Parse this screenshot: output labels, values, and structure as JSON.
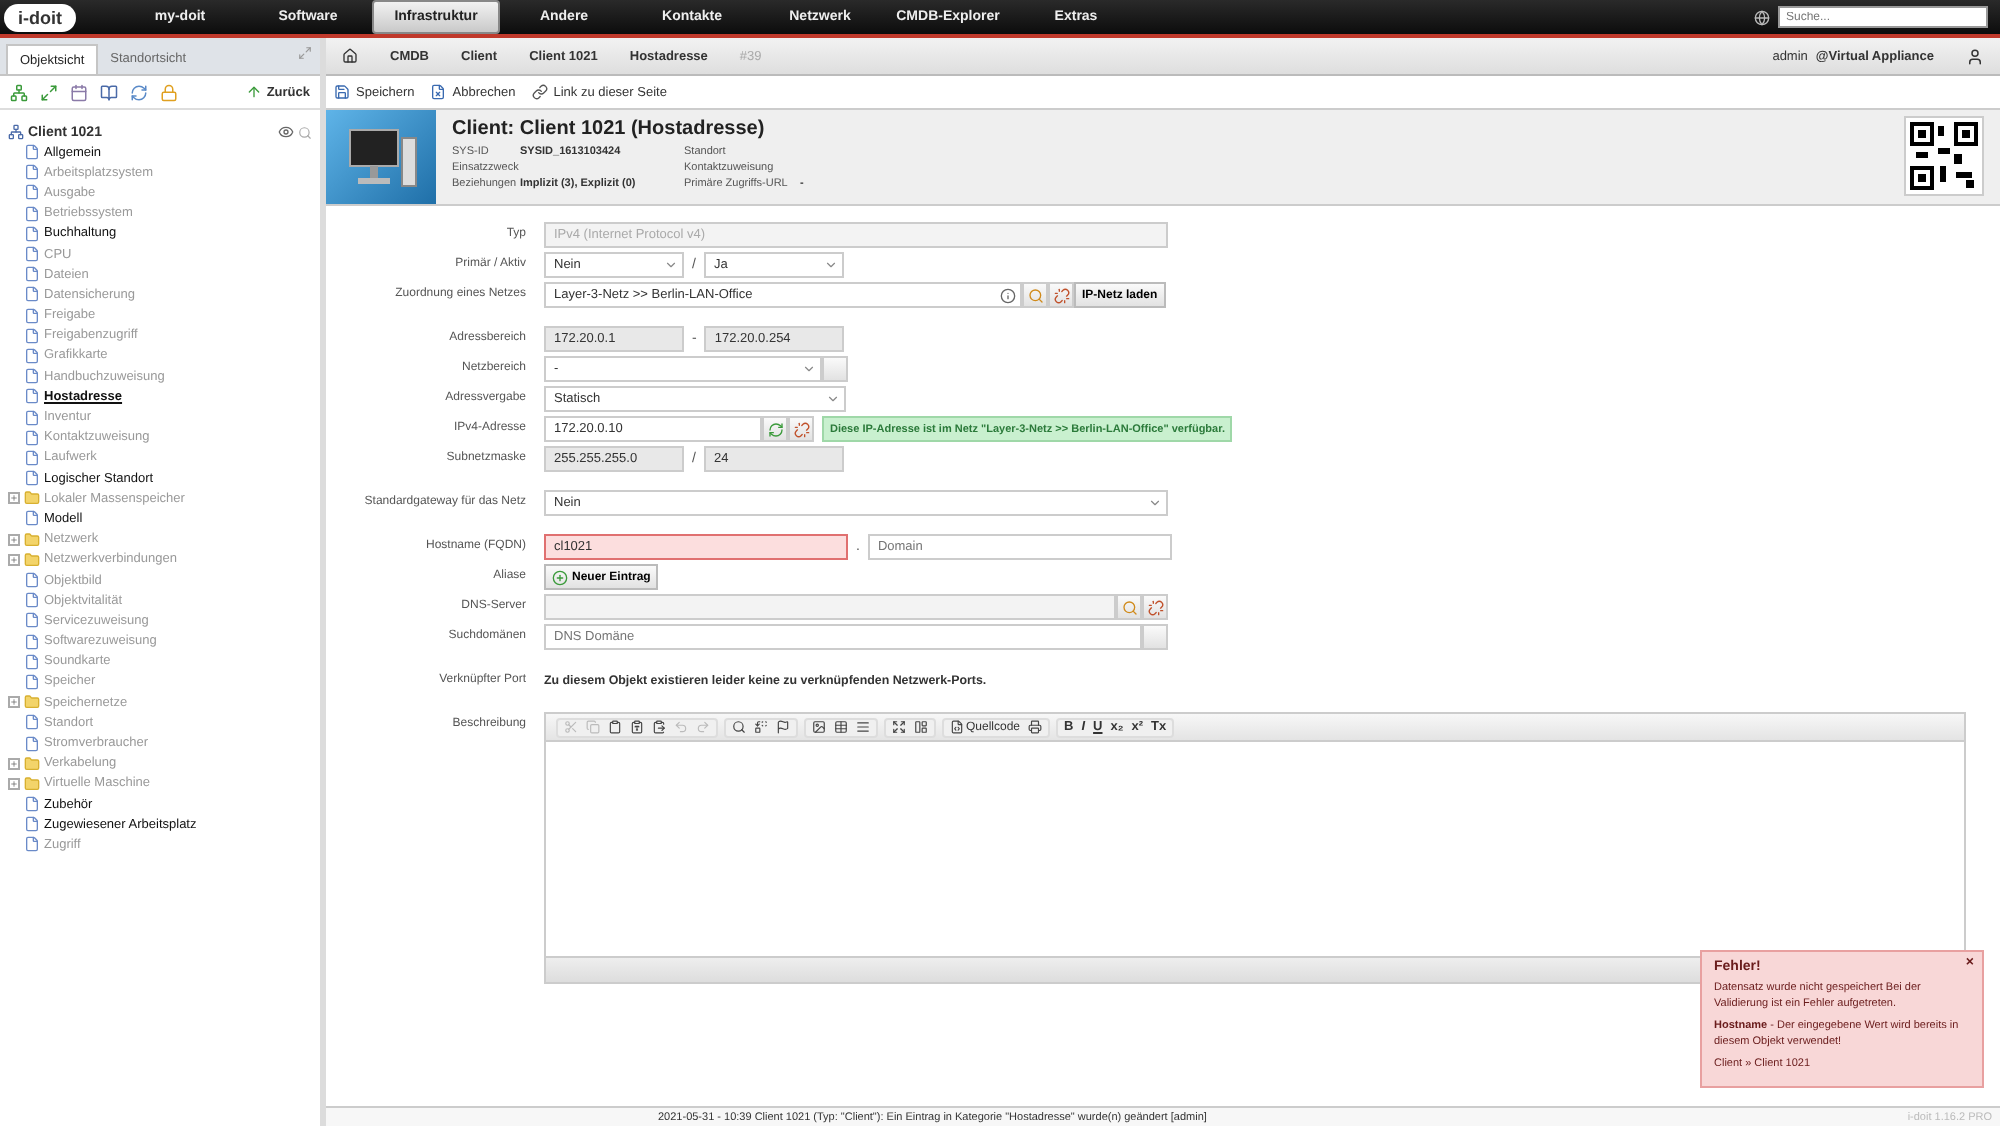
{
  "nav": {
    "logo": "i-doit",
    "items": [
      {
        "label": "my-doit",
        "selected": false
      },
      {
        "label": "Software",
        "selected": false
      },
      {
        "label": "Infrastruktur",
        "selected": true
      },
      {
        "label": "Andere",
        "selected": false
      },
      {
        "label": "Kontakte",
        "selected": false
      },
      {
        "label": "Netzwerk",
        "selected": false
      },
      {
        "label": "CMDB-Explorer",
        "selected": false
      },
      {
        "label": "Extras",
        "selected": false
      }
    ],
    "search": {
      "placeholder": "Suche..."
    }
  },
  "left_panel": {
    "tabs": [
      {
        "label": "Objektsicht",
        "selected": true
      },
      {
        "label": "Standortsicht",
        "selected": false
      }
    ],
    "back": "Zurück",
    "tree": {
      "root": "Client 1021",
      "items": [
        {
          "label": "Allgemein",
          "kind": "page",
          "has_data": true,
          "selected": false
        },
        {
          "label": "Arbeitsplatzsystem",
          "kind": "page",
          "has_data": false,
          "selected": false
        },
        {
          "label": "Ausgabe",
          "kind": "page",
          "has_data": false,
          "selected": false
        },
        {
          "label": "Betriebssystem",
          "kind": "page",
          "has_data": false,
          "selected": false
        },
        {
          "label": "Buchhaltung",
          "kind": "page",
          "has_data": true,
          "selected": false
        },
        {
          "label": "CPU",
          "kind": "page",
          "has_data": false,
          "selected": false
        },
        {
          "label": "Dateien",
          "kind": "page",
          "has_data": false,
          "selected": false
        },
        {
          "label": "Datensicherung",
          "kind": "page",
          "has_data": false,
          "selected": false
        },
        {
          "label": "Freigabe",
          "kind": "page",
          "has_data": false,
          "selected": false
        },
        {
          "label": "Freigabenzugriff",
          "kind": "page",
          "has_data": false,
          "selected": false
        },
        {
          "label": "Grafikkarte",
          "kind": "page",
          "has_data": false,
          "selected": false
        },
        {
          "label": "Handbuchzuweisung",
          "kind": "page",
          "has_data": false,
          "selected": false
        },
        {
          "label": "Hostadresse",
          "kind": "page",
          "has_data": true,
          "selected": true
        },
        {
          "label": "Inventur",
          "kind": "page",
          "has_data": false,
          "selected": false
        },
        {
          "label": "Kontaktzuweisung",
          "kind": "page",
          "has_data": false,
          "selected": false
        },
        {
          "label": "Laufwerk",
          "kind": "page",
          "has_data": false,
          "selected": false
        },
        {
          "label": "Logischer Standort",
          "kind": "page",
          "has_data": true,
          "selected": false
        },
        {
          "label": "Lokaler Massenspeicher",
          "kind": "folder",
          "expanded": false,
          "has_data": false,
          "selected": false
        },
        {
          "label": "Modell",
          "kind": "page",
          "has_data": true,
          "selected": false
        },
        {
          "label": "Netzwerk",
          "kind": "folder",
          "expanded": false,
          "has_data": false,
          "selected": false
        },
        {
          "label": "Netzwerkverbindungen",
          "kind": "folder",
          "expanded": false,
          "has_data": false,
          "selected": false
        },
        {
          "label": "Objektbild",
          "kind": "page",
          "has_data": false,
          "selected": false
        },
        {
          "label": "Objektvitalität",
          "kind": "page",
          "has_data": false,
          "selected": false
        },
        {
          "label": "Servicezuweisung",
          "kind": "page",
          "has_data": false,
          "selected": false
        },
        {
          "label": "Softwarezuweisung",
          "kind": "page",
          "has_data": false,
          "selected": false
        },
        {
          "label": "Soundkarte",
          "kind": "page",
          "has_data": false,
          "selected": false
        },
        {
          "label": "Speicher",
          "kind": "page",
          "has_data": false,
          "selected": false
        },
        {
          "label": "Speichernetze",
          "kind": "folder",
          "expanded": false,
          "has_data": false,
          "selected": false
        },
        {
          "label": "Standort",
          "kind": "page",
          "has_data": false,
          "selected": false
        },
        {
          "label": "Stromverbraucher",
          "kind": "page",
          "has_data": false,
          "selected": false
        },
        {
          "label": "Verkabelung",
          "kind": "folder",
          "expanded": false,
          "has_data": false,
          "selected": false
        },
        {
          "label": "Virtuelle Maschine",
          "kind": "folder",
          "expanded": false,
          "has_data": false,
          "selected": false
        },
        {
          "label": "Zubehör",
          "kind": "page",
          "has_data": true,
          "selected": false
        },
        {
          "label": "Zugewiesener Arbeitsplatz",
          "kind": "page",
          "has_data": true,
          "selected": false
        },
        {
          "label": "Zugriff",
          "kind": "page",
          "has_data": false,
          "selected": false
        }
      ]
    }
  },
  "breadcrumb": {
    "items": [
      "CMDB",
      "Client",
      "Client 1021",
      "Hostadresse"
    ],
    "id": "#39",
    "user": "admin",
    "tenant": "@Virtual Appliance"
  },
  "actions": [
    "Speichern",
    "Abbrechen",
    "Link zu dieser Seite"
  ],
  "object": {
    "title": "Client: Client 1021 (Hostadresse)",
    "meta": [
      {
        "label": "SYS-ID",
        "value": "SYSID_1613103424"
      },
      {
        "label": "Einsatzzweck"
      },
      {
        "label": "Beziehungen",
        "value": "Implizit (3), Explizit (0)"
      },
      {
        "label": "Standort"
      },
      {
        "label": "Kontaktzuweisung"
      },
      {
        "label": "Primäre Zugriffs-URL",
        "value": "-"
      }
    ]
  },
  "form": {
    "sections": [
      [
        {
          "label": "Typ",
          "parts": [
            {
              "kind": "input",
              "value": "IPv4 (Internet Protocol v4)",
              "disabled": true
            }
          ]
        },
        {
          "label": "Primär / Aktiv",
          "parts": [
            {
              "kind": "select",
              "value": "Nein"
            },
            {
              "kind": "sep",
              "text": "/"
            },
            {
              "kind": "select",
              "value": "Ja"
            }
          ]
        },
        {
          "label": "Zuordnung eines Netzes",
          "parts": [
            {
              "kind": "input",
              "value": "Layer-3-Netz >> Berlin-LAN-Office",
              "info": true
            },
            {
              "kind": "search"
            },
            {
              "kind": "detach"
            },
            {
              "kind": "button",
              "text": "IP-Netz laden"
            }
          ]
        }
      ],
      [
        {
          "label": "Adressbereich",
          "parts": [
            {
              "kind": "input",
              "value": "172.20.0.1",
              "readonly": true
            },
            {
              "kind": "sep",
              "text": "-"
            },
            {
              "kind": "input",
              "value": "172.20.0.254",
              "readonly": true
            }
          ]
        },
        {
          "label": "Netzbereich",
          "parts": [
            {
              "kind": "select",
              "value": "-"
            },
            {
              "kind": "blank"
            }
          ]
        },
        {
          "label": "Adressvergabe",
          "parts": [
            {
              "kind": "select",
              "value": "Statisch"
            }
          ]
        },
        {
          "label": "IPv4-Adresse",
          "parts": [
            {
              "kind": "input",
              "value": "172.20.0.10"
            },
            {
              "kind": "refresh"
            },
            {
              "kind": "detach"
            },
            {
              "kind": "message",
              "text": "Diese IP-Adresse ist im Netz \"Layer-3-Netz >> Berlin-LAN-Office\" verfügbar."
            }
          ]
        },
        {
          "label": "Subnetzmaske",
          "parts": [
            {
              "kind": "input",
              "value": "255.255.255.0",
              "readonly": true
            },
            {
              "kind": "sep",
              "text": "/"
            },
            {
              "kind": "input",
              "value": "24",
              "readonly": true
            }
          ]
        }
      ],
      [
        {
          "label": "Standardgateway für das Netz",
          "parts": [
            {
              "kind": "select",
              "value": "Nein"
            }
          ]
        }
      ],
      [
        {
          "label": "Hostname (FQDN)",
          "parts": [
            {
              "kind": "input",
              "value": "cl1021",
              "error": true
            },
            {
              "kind": "sep",
              "text": "."
            },
            {
              "kind": "input",
              "placeholder": "Domain"
            }
          ]
        },
        {
          "label": "Aliase",
          "parts": [
            {
              "kind": "add",
              "text": "Neuer Eintrag"
            }
          ]
        },
        {
          "label": "DNS-Server",
          "parts": [
            {
              "kind": "input",
              "disabled": true
            },
            {
              "kind": "search"
            },
            {
              "kind": "detach"
            }
          ]
        },
        {
          "label": "Suchdomänen",
          "parts": [
            {
              "kind": "input",
              "placeholder": "DNS Domäne"
            },
            {
              "kind": "blank"
            }
          ]
        }
      ],
      [
        {
          "label": "Verknüpfter Port",
          "parts": [
            {
              "kind": "text",
              "text": "Zu diesem Objekt existieren leider keine zu verknüpfenden Netzwerk-Ports."
            }
          ]
        }
      ],
      [
        {
          "label": "Beschreibung",
          "parts": [
            {
              "kind": "editor",
              "source": "Quellcode",
              "format": [
                "B",
                "I",
                "U",
                "x₂",
                "x²",
                "Tx"
              ]
            }
          ]
        }
      ]
    ]
  },
  "toast": {
    "close": "×",
    "title": "Fehler!",
    "lines": [
      "Datensatz wurde nicht gespeichert Bei der Validierung ist ein Fehler aufgetreten.",
      "**Hostname** - Der eingegebene Wert wird bereits in diesem Objekt verwendet!",
      "Client » Client 1021"
    ]
  },
  "status_bar": {
    "message": "2021-05-31 - 10:39 Client 1021 (Typ: \"Client\"): Ein Eintrag in Kategorie \"Hostadresse\" wurde(n) geändert [admin]",
    "version": "i-doit 1.16.2 PRO"
  }
}
